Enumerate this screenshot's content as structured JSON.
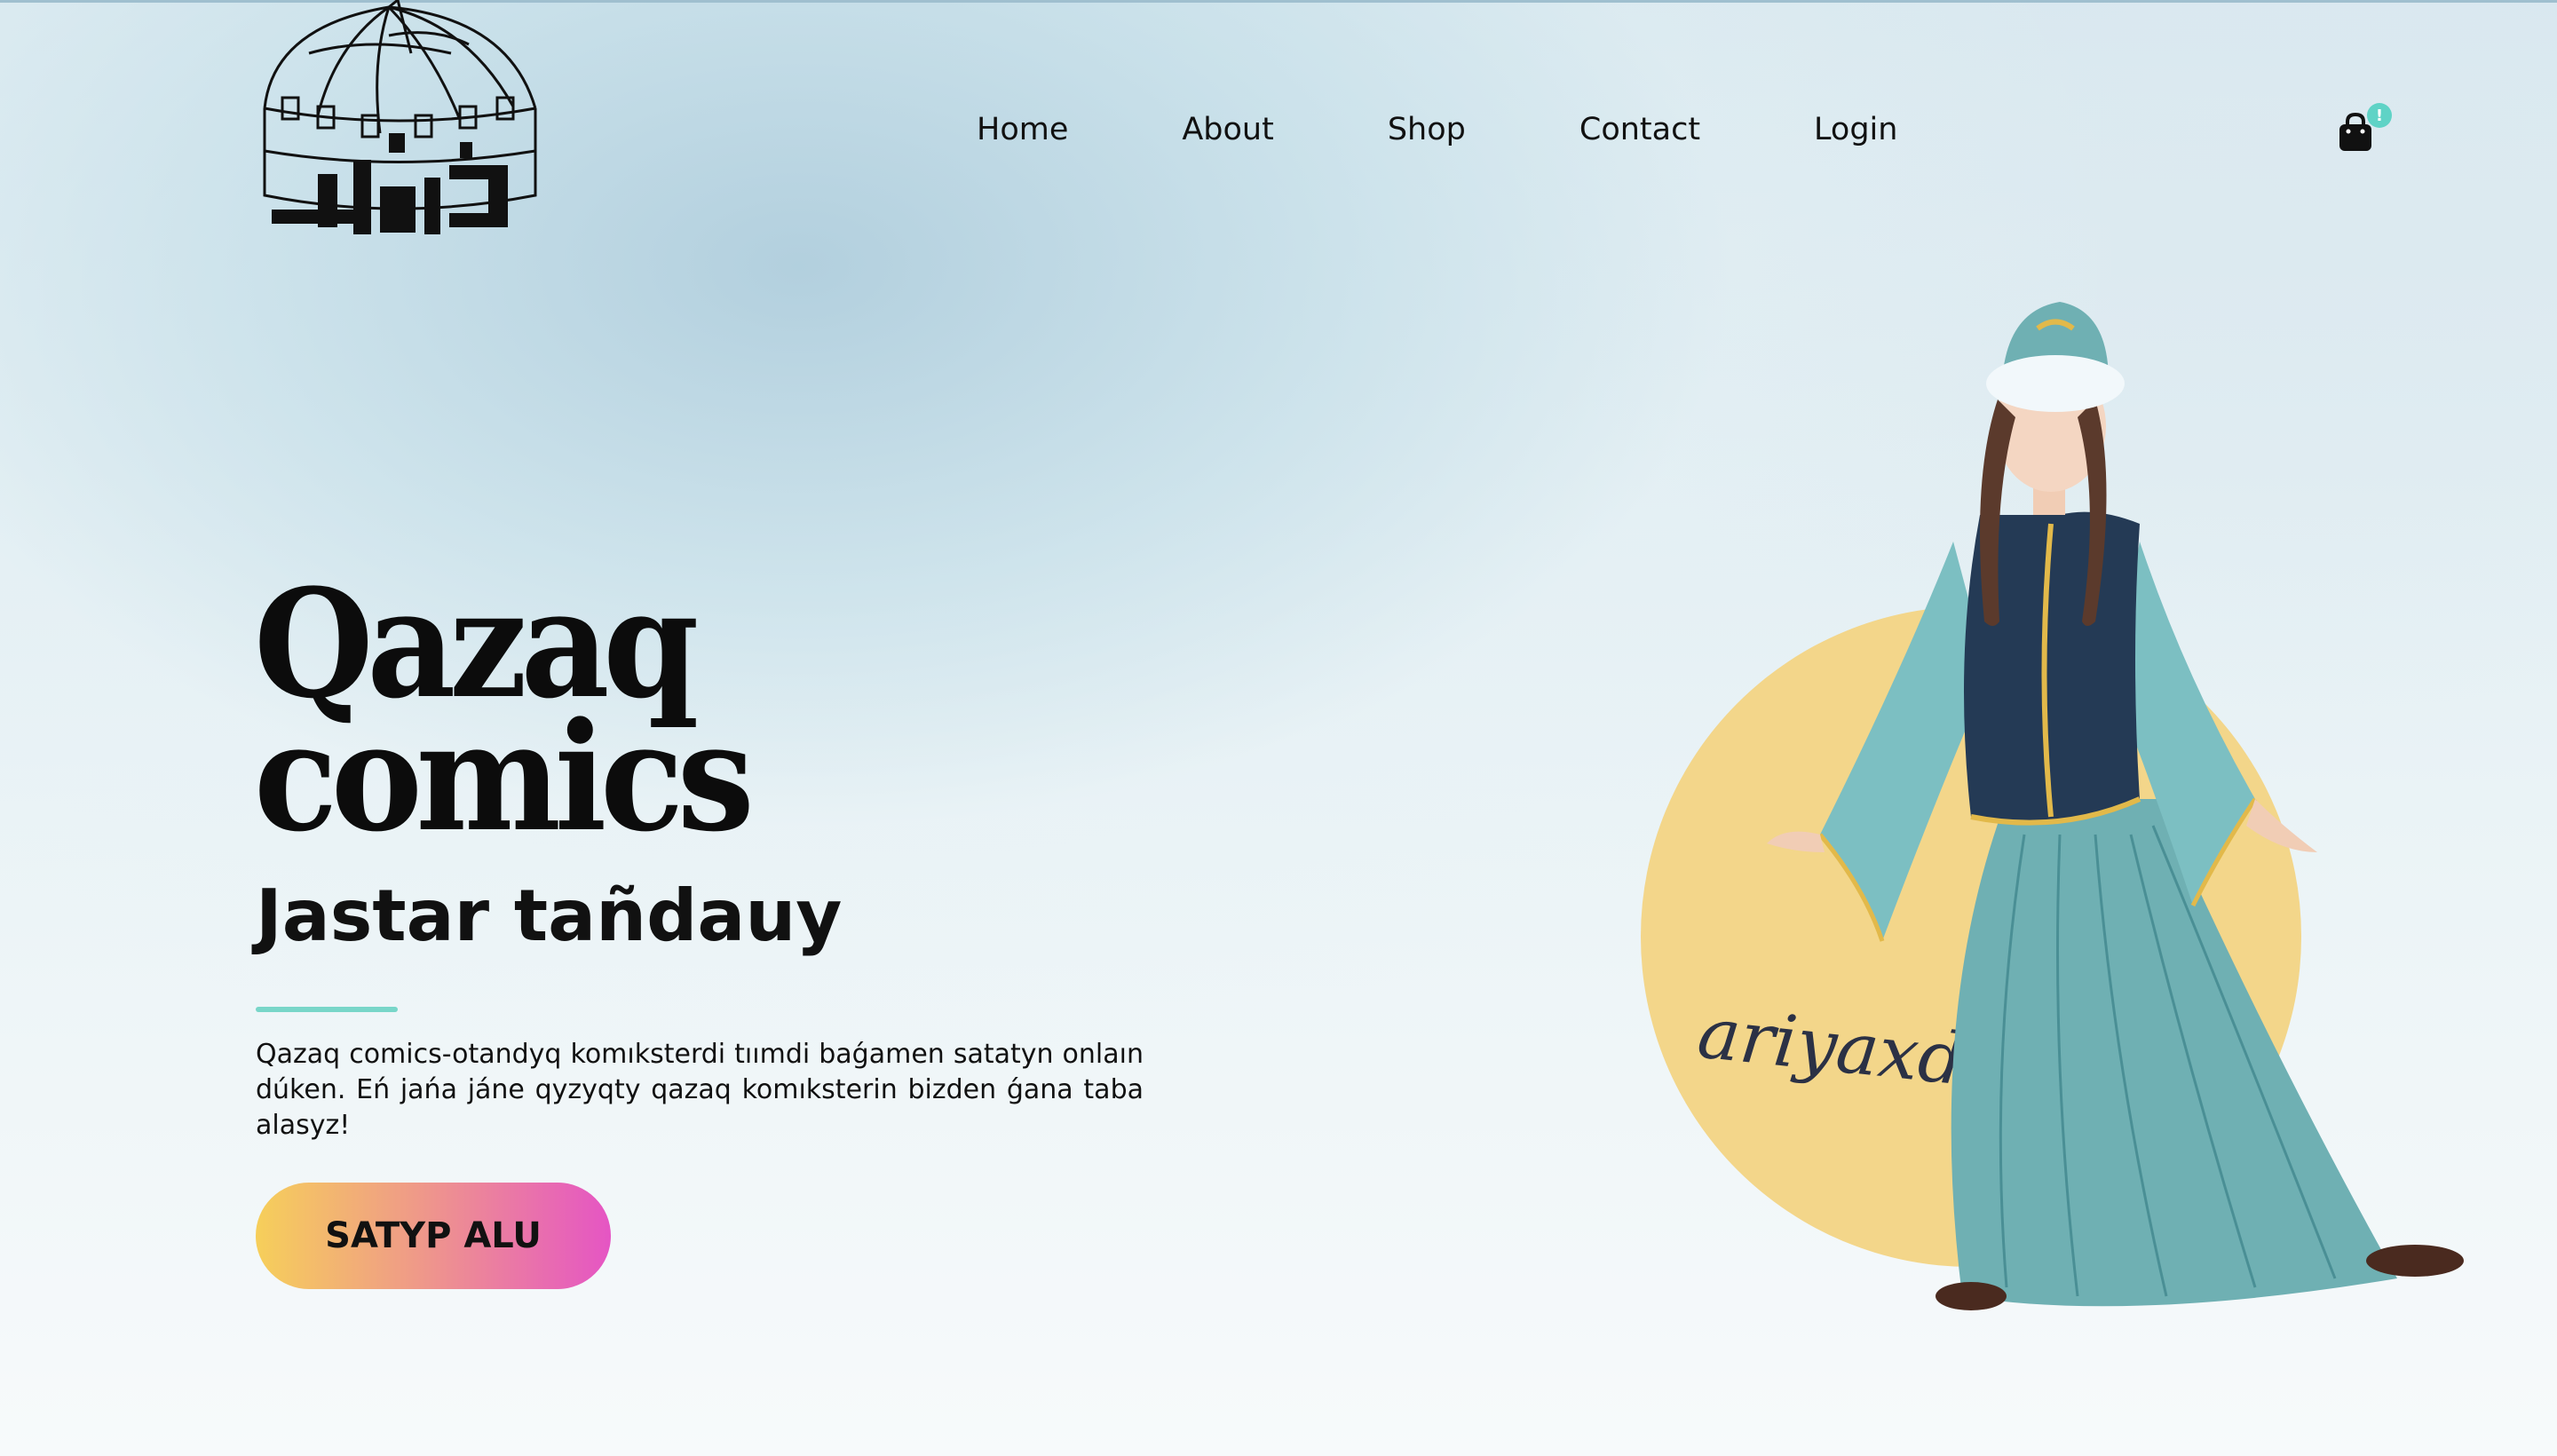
{
  "header": {
    "logo_alt": "Qazaq comics logo",
    "nav": [
      {
        "label": "Home"
      },
      {
        "label": "About"
      },
      {
        "label": "Shop"
      },
      {
        "label": "Contact"
      },
      {
        "label": "Login"
      }
    ],
    "cart_icon": "shopping-bag-icon",
    "cart_badge": "!"
  },
  "hero": {
    "title_line1": "Qazaq",
    "title_line2": "comics",
    "subtitle": "Jastar tañdauy",
    "description": "Qazaq comics-otandyq komıksterdi tıımdi baǵamen satatyn onlaın dúken. Eń jańa jáne qyzyqty qazaq komıksterin bizden ǵana taba alasyz!",
    "cta_label": "SATYP ALU"
  },
  "illustration": {
    "signature": "ariyaxd",
    "circle_color": "#f3d68a",
    "dress_color": "#6fb0b3",
    "vest_color": "#243a55"
  }
}
